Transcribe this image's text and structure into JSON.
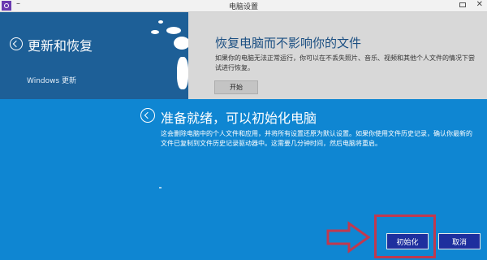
{
  "window": {
    "title": "电脑设置",
    "minimize_glyph": "–",
    "close_glyph": "✕"
  },
  "left_pane": {
    "heading": "更新和恢复",
    "item": "Windows 更新"
  },
  "right_pane": {
    "title": "恢复电脑而不影响你的文件",
    "description_lines": [
      "如果你的电脑无法正常运行，你可以在不丢失照片、音乐、视频和其他个人文件的情况下尝",
      "试进行恢复。"
    ],
    "start_button": "开始"
  },
  "dialog": {
    "title": "准备就绪，可以初始化电脑",
    "description": "这会删除电脑中的个人文件和应用，并将所有设置还原为默认设置。如果你使用文件历史记录，确认你最新的文件已复制到文件历史记录驱动器中。这需要几分钟时间，然后电脑将重启。",
    "confirm_button": "初始化",
    "cancel_button": "取消"
  },
  "colors": {
    "left_pane_bg": "#1d5f97",
    "dialog_bg": "#0f86d2",
    "button_bg": "#1e2f9e",
    "highlight": "#c0394f"
  }
}
